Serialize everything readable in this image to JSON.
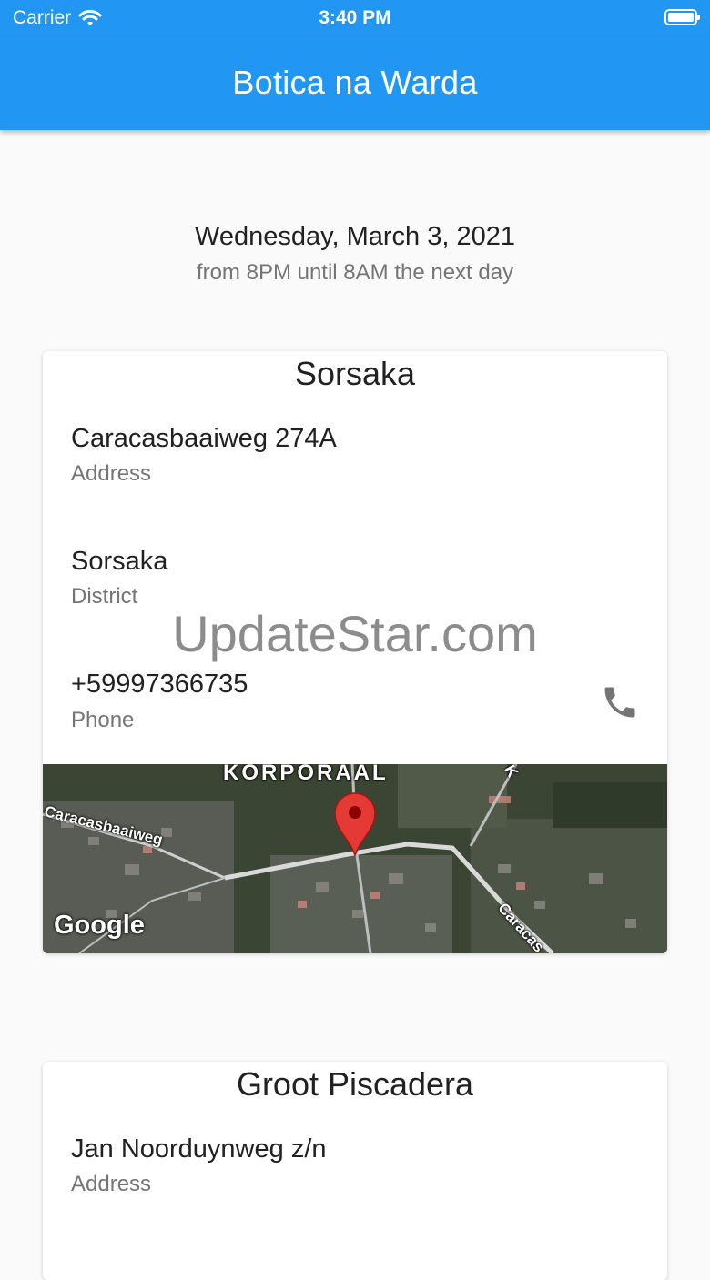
{
  "status_bar": {
    "carrier": "Carrier",
    "time": "3:40 PM"
  },
  "app_bar": {
    "title": "Botica na Warda"
  },
  "schedule": {
    "date": "Wednesday, March 3, 2021",
    "hours": "from 8PM until 8AM the next day"
  },
  "pharmacies": [
    {
      "name": "Sorsaka",
      "address": "Caracasbaaiweg 274A",
      "address_label": "Address",
      "district": "Sorsaka",
      "district_label": "District",
      "phone": "+59997366735",
      "phone_label": "Phone",
      "map": {
        "labels": [
          "KORPORAAL",
          "Caracasbaaiweg",
          "Caracas",
          "K"
        ],
        "attribution": "Google",
        "marker_color": "#e53935"
      }
    },
    {
      "name": "Groot Piscadera",
      "address": "Jan Noorduynweg z/n",
      "address_label": "Address"
    }
  ],
  "watermark": "UpdateStar.com",
  "colors": {
    "primary": "#2196f3",
    "background": "#fafafa",
    "secondary_text": "#757575"
  }
}
